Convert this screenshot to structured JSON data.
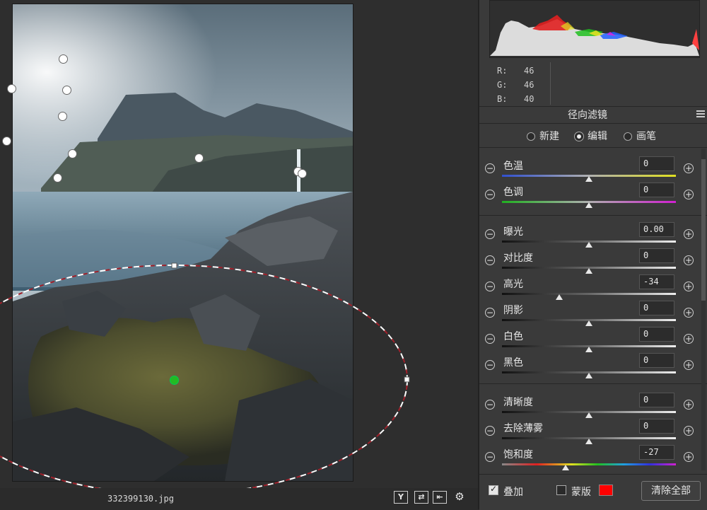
{
  "document": {
    "filename": "332399130.jpg"
  },
  "toolbar": {
    "buttons": [
      {
        "name": "y-toggle-button",
        "label": "Y"
      },
      {
        "name": "swap-button",
        "label": "⇄"
      },
      {
        "name": "copy-button",
        "label": "⇤"
      },
      {
        "name": "settings-button",
        "label": "⚙"
      }
    ]
  },
  "histogram": {
    "r_label": "R:",
    "r_value": "46",
    "g_label": "G:",
    "g_value": "46",
    "b_label": "B:",
    "b_value": "40"
  },
  "panel": {
    "title": "径向滤镜",
    "modes": [
      {
        "label": "新建",
        "selected": false
      },
      {
        "label": "编辑",
        "selected": true
      },
      {
        "label": "画笔",
        "selected": false
      }
    ],
    "sliders": [
      {
        "label": "色温",
        "value": "0",
        "fraction": 0.5,
        "track": "temp"
      },
      {
        "label": "色调",
        "value": "0",
        "fraction": 0.5,
        "track": "tint"
      },
      {
        "label": "曝光",
        "value": "0.00",
        "fraction": 0.5,
        "track": "gray"
      },
      {
        "label": "对比度",
        "value": "0",
        "fraction": 0.5,
        "track": "gray"
      },
      {
        "label": "高光",
        "value": "-34",
        "fraction": 0.33,
        "track": "gray"
      },
      {
        "label": "阴影",
        "value": "0",
        "fraction": 0.5,
        "track": "gray"
      },
      {
        "label": "白色",
        "value": "0",
        "fraction": 0.5,
        "track": "gray"
      },
      {
        "label": "黑色",
        "value": "0",
        "fraction": 0.5,
        "track": "gray"
      },
      {
        "label": "清晰度",
        "value": "0",
        "fraction": 0.5,
        "track": "gray"
      },
      {
        "label": "去除薄雾",
        "value": "0",
        "fraction": 0.5,
        "track": "gray"
      },
      {
        "label": "饱和度",
        "value": "-27",
        "fraction": 0.365,
        "track": "sat"
      }
    ]
  },
  "footer": {
    "overlay_label": "叠加",
    "overlay_checked": true,
    "mask_label": "蒙版",
    "mask_checked": false,
    "mask_color": "#ff0000",
    "clear_label": "清除全部"
  },
  "colors": {
    "accent": "#ff0000",
    "pin_active": "#22bb22"
  }
}
